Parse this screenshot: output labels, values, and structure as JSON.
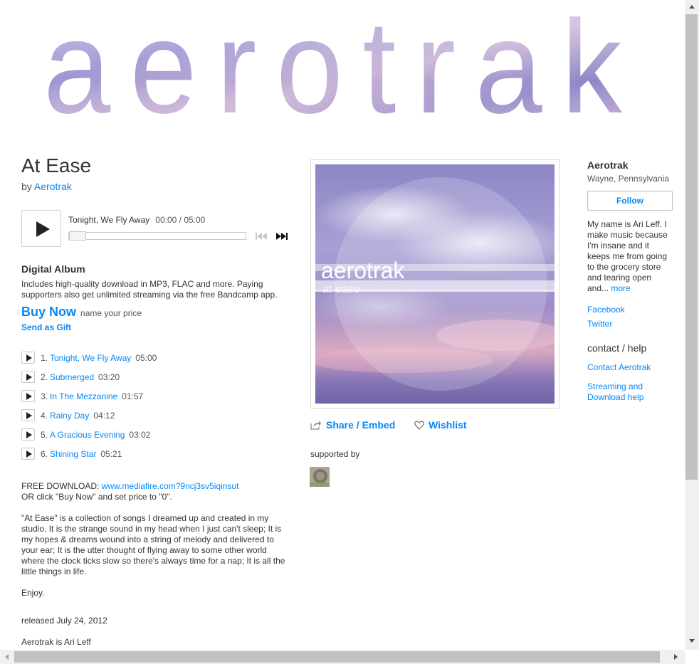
{
  "banner": {
    "text": "aerotrak"
  },
  "album": {
    "title": "At Ease",
    "by_prefix": "by",
    "artist": "Aerotrak"
  },
  "player": {
    "track_title": "Tonight, We Fly Away",
    "time": "00:00 / 05:00",
    "progress_fraction": 0
  },
  "digital_album": {
    "heading": "Digital Album",
    "description": "Includes high-quality download in MP3, FLAC and more. Paying supporters also get unlimited streaming via the free Bandcamp app.",
    "buy_now": "Buy Now",
    "price_note": "name your price",
    "send_gift": "Send as Gift"
  },
  "tracks": [
    {
      "num": "1.",
      "title": "Tonight, We Fly Away",
      "duration": "05:00"
    },
    {
      "num": "2.",
      "title": "Submerged",
      "duration": "03:20"
    },
    {
      "num": "3.",
      "title": "In The Mezzanine",
      "duration": "01:57"
    },
    {
      "num": "4.",
      "title": "Rainy Day",
      "duration": "04:12"
    },
    {
      "num": "5.",
      "title": "A Gracious Evening",
      "duration": "03:02"
    },
    {
      "num": "6.",
      "title": "Shining Star",
      "duration": "05:21"
    }
  ],
  "about": {
    "free_label": "FREE DOWNLOAD: ",
    "free_link": "www.mediafire.com?9ncj3sv5iqinsut",
    "free_note": "OR click \"Buy Now\" and set price to \"0\".",
    "description": "\"At Ease\" is a collection of songs I dreamed up and created in my studio. It is the strange sound in my head when I just can't sleep; It is my hopes & dreams wound into a string of melody and delivered to your ear; It is the utter thought of flying away to some other world where the clock ticks slow so there's always time for a nap; It is all the little things in life.",
    "enjoy": "Enjoy.",
    "released": "released July 24, 2012",
    "credits": "Aerotrak is Ari Leff"
  },
  "cover": {
    "artist_text": "aerotrak",
    "album_text": "at ease"
  },
  "actions": {
    "share": "Share / Embed",
    "wishlist": "Wishlist"
  },
  "supported_by": "supported by",
  "sidebar": {
    "name": "Aerotrak",
    "location": "Wayne, Pennsylvania",
    "follow": "Follow",
    "bio": "My name is Ari Leff. I make music because I'm insane and it keeps me from going to the grocery store and tearing open and...",
    "more": "more",
    "links": [
      "Facebook",
      "Twitter"
    ],
    "contact_heading": "contact / help",
    "contact_links": [
      "Contact Aerotrak",
      "Streaming and Download help"
    ]
  },
  "colors": {
    "link": "#0687f5",
    "text": "#333333",
    "sky_purple": "#8f87c8",
    "sky_pink": "#d9a7be"
  },
  "icons": [
    "play-icon",
    "prev-track-icon",
    "next-track-icon",
    "share-icon",
    "heart-icon"
  ]
}
